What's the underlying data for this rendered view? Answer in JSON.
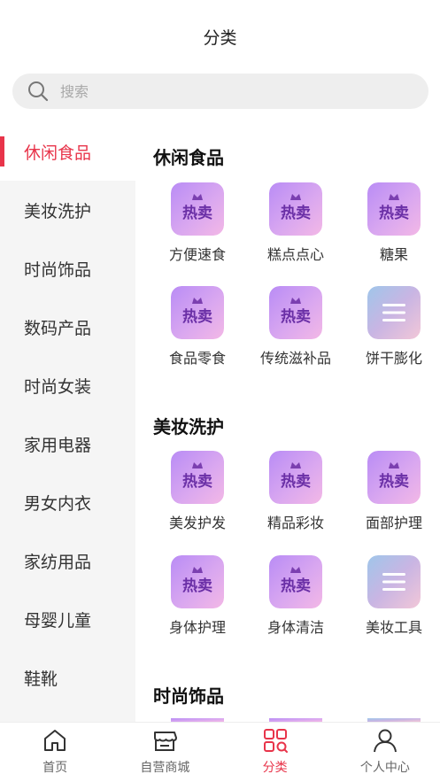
{
  "header": {
    "title": "分类"
  },
  "search": {
    "placeholder": "搜索"
  },
  "colors": {
    "accent": "#e8344a",
    "sidebar_bg": "#f5f5f5"
  },
  "sidebar": {
    "items": [
      {
        "label": "休闲食品",
        "active": true
      },
      {
        "label": "美妆洗护"
      },
      {
        "label": "时尚饰品"
      },
      {
        "label": "数码产品"
      },
      {
        "label": "时尚女装"
      },
      {
        "label": "家用电器"
      },
      {
        "label": "男女内衣"
      },
      {
        "label": "家纺用品"
      },
      {
        "label": "母婴儿童"
      },
      {
        "label": "鞋靴"
      }
    ]
  },
  "sections": [
    {
      "title": "休闲食品",
      "items": [
        {
          "label": "方便速食",
          "icon": "hot-sale-icon",
          "badge": "热卖"
        },
        {
          "label": "糕点点心",
          "icon": "hot-sale-icon",
          "badge": "热卖"
        },
        {
          "label": "糖果",
          "icon": "hot-sale-icon",
          "badge": "热卖"
        },
        {
          "label": "食品零食",
          "icon": "hot-sale-icon",
          "badge": "热卖"
        },
        {
          "label": "传统滋补品",
          "icon": "hot-sale-icon",
          "badge": "热卖"
        },
        {
          "label": "饼干膨化",
          "icon": "menu-icon"
        }
      ]
    },
    {
      "title": "美妆洗护",
      "items": [
        {
          "label": "美发护发",
          "icon": "hot-sale-icon",
          "badge": "热卖"
        },
        {
          "label": "精品彩妆",
          "icon": "hot-sale-icon",
          "badge": "热卖"
        },
        {
          "label": "面部护理",
          "icon": "hot-sale-icon",
          "badge": "热卖"
        },
        {
          "label": "身体护理",
          "icon": "hot-sale-icon",
          "badge": "热卖"
        },
        {
          "label": "身体清洁",
          "icon": "hot-sale-icon",
          "badge": "热卖"
        },
        {
          "label": "美妆工具",
          "icon": "menu-icon"
        }
      ]
    },
    {
      "title": "时尚饰品",
      "items": []
    }
  ],
  "tabbar": {
    "items": [
      {
        "label": "首页",
        "icon": "home-icon"
      },
      {
        "label": "自营商城",
        "icon": "store-icon"
      },
      {
        "label": "分类",
        "icon": "category-icon",
        "active": true
      },
      {
        "label": "个人中心",
        "icon": "user-icon"
      }
    ]
  }
}
